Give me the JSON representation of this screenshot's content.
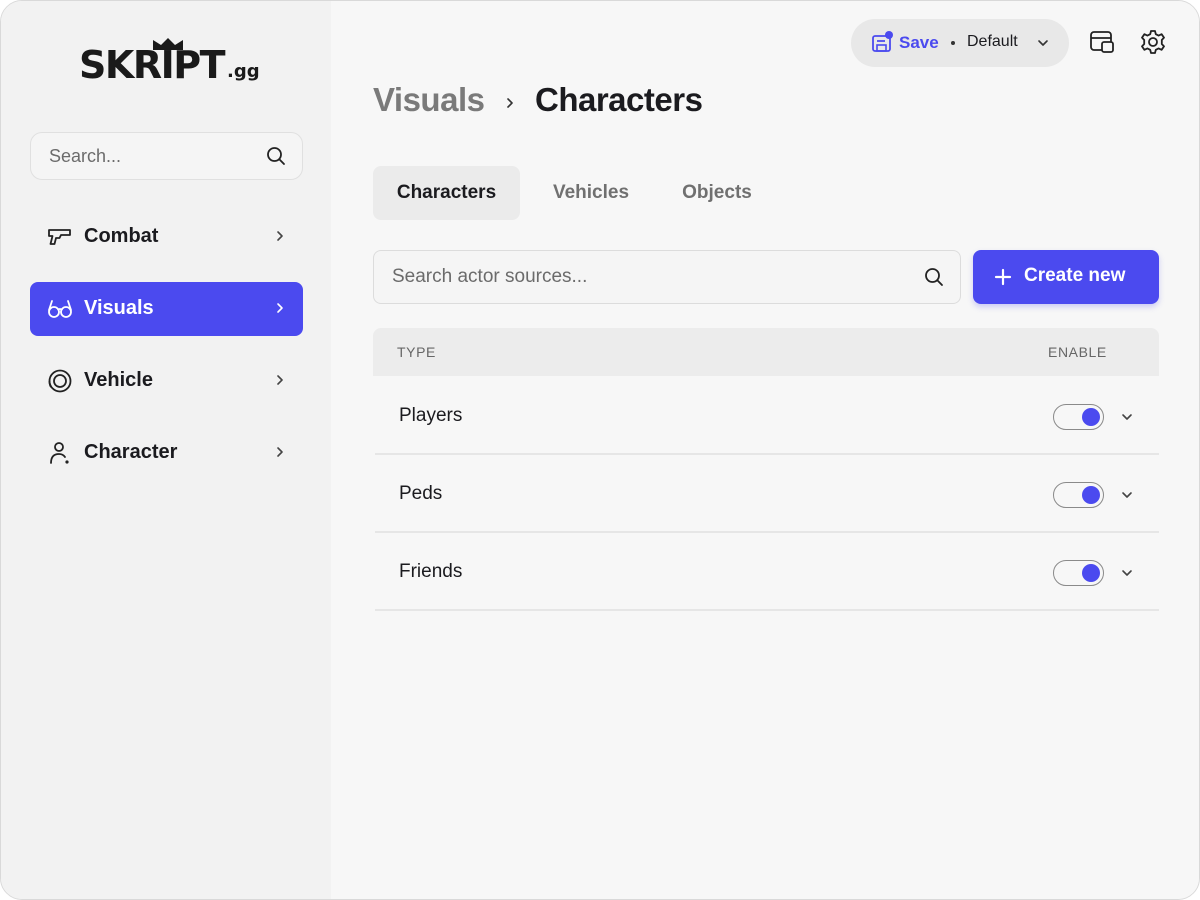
{
  "app": {
    "logo_text": "SKRIPT",
    "logo_suffix": ".gg"
  },
  "sidebar": {
    "search_placeholder": "Search...",
    "items": [
      {
        "label": "Combat",
        "icon": "gun-icon",
        "active": false
      },
      {
        "label": "Visuals",
        "icon": "glasses-icon",
        "active": true
      },
      {
        "label": "Vehicle",
        "icon": "wheel-icon",
        "active": false
      },
      {
        "label": "Character",
        "icon": "person-icon",
        "active": false
      }
    ]
  },
  "topbar": {
    "save_label": "Save",
    "profile_label": "Default"
  },
  "breadcrumb": {
    "parent": "Visuals",
    "current": "Characters"
  },
  "tabs": [
    {
      "label": "Characters",
      "active": true
    },
    {
      "label": "Vehicles",
      "active": false
    },
    {
      "label": "Objects",
      "active": false
    }
  ],
  "actor_search": {
    "placeholder": "Search actor sources..."
  },
  "create_button": {
    "label": "Create new"
  },
  "table": {
    "columns": [
      "TYPE",
      "ENABLE"
    ],
    "rows": [
      {
        "label": "Players",
        "enabled": true
      },
      {
        "label": "Peds",
        "enabled": true
      },
      {
        "label": "Friends",
        "enabled": true
      }
    ]
  },
  "colors": {
    "accent": "#4b4aef",
    "sidebar_bg": "#f2f2f2",
    "main_bg": "#f7f7f7"
  }
}
